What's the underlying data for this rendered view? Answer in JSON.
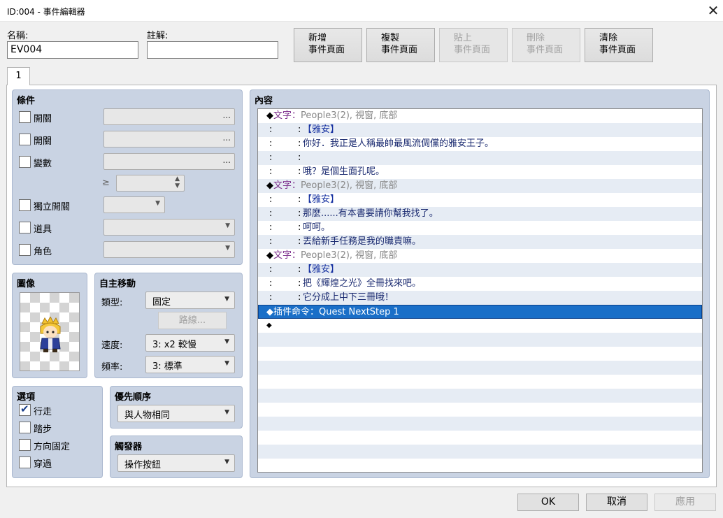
{
  "window": {
    "title": "ID:004 - 事件編輯器",
    "close_icon": "close-icon"
  },
  "header": {
    "name_label": "名稱:",
    "name_value": "EV004",
    "note_label": "註解:",
    "note_value": ""
  },
  "toolbar": {
    "buttons": [
      {
        "line1": "新增",
        "line2": "事件頁面",
        "enabled": true
      },
      {
        "line1": "複製",
        "line2": "事件頁面",
        "enabled": true
      },
      {
        "line1": "貼上",
        "line2": "事件頁面",
        "enabled": false
      },
      {
        "line1": "刪除",
        "line2": "事件頁面",
        "enabled": false
      },
      {
        "line1": "清除",
        "line2": "事件頁面",
        "enabled": true
      }
    ]
  },
  "tabs": [
    {
      "label": "1"
    }
  ],
  "conditions": {
    "title": "條件",
    "switch1_label": "開關",
    "switch2_label": "開關",
    "variable_label": "變數",
    "gte_symbol": "≥",
    "self_switch_label": "獨立開關",
    "item_label": "道具",
    "actor_label": "角色",
    "dots": "..."
  },
  "image": {
    "title": "圖像",
    "sprite": "character-sprite"
  },
  "autonomous": {
    "title": "自主移動",
    "type_label": "類型:",
    "type_value": "固定",
    "route_button": "路線...",
    "speed_label": "速度:",
    "speed_value": "3: x2 較慢",
    "freq_label": "頻率:",
    "freq_value": "3: 標準"
  },
  "options": {
    "title": "選項",
    "items": [
      {
        "label": "行走",
        "checked": true
      },
      {
        "label": "踏步",
        "checked": false
      },
      {
        "label": "方向固定",
        "checked": false
      },
      {
        "label": "穿過",
        "checked": false
      }
    ]
  },
  "priority": {
    "title": "優先順序",
    "value": "與人物相同"
  },
  "trigger": {
    "title": "觸發器",
    "value": "操作按鈕"
  },
  "contents": {
    "title": "內容",
    "rows": [
      {
        "type": "cmd",
        "cmd": "文字",
        "sep": "：",
        "param": "People3(2), 視窗, 底部"
      },
      {
        "type": "line",
        "c1": ":",
        "c2": ":",
        "text": "【雅安】",
        "style": "name"
      },
      {
        "type": "line",
        "c1": ":",
        "c2": ":",
        "text": "你好．我正是人稱最帥最風流倜儻的雅安王子。",
        "style": "msg"
      },
      {
        "type": "line",
        "c1": ":",
        "c2": ":",
        "text": "",
        "style": "msg"
      },
      {
        "type": "line",
        "c1": ":",
        "c2": ":",
        "text": "哦？是個生面孔呢。",
        "style": "msg"
      },
      {
        "type": "cmd",
        "cmd": "文字",
        "sep": "：",
        "param": "People3(2), 視窗, 底部"
      },
      {
        "type": "line",
        "c1": ":",
        "c2": ":",
        "text": "【雅安】",
        "style": "name"
      },
      {
        "type": "line",
        "c1": ":",
        "c2": ":",
        "text": "那麼......有本書要請你幫我找了。",
        "style": "msg"
      },
      {
        "type": "line",
        "c1": ":",
        "c2": ":",
        "text": "呵呵。",
        "style": "msg"
      },
      {
        "type": "line",
        "c1": ":",
        "c2": ":",
        "text": "丟給新手任務是我的職責嘛。",
        "style": "msg"
      },
      {
        "type": "cmd",
        "cmd": "文字",
        "sep": "：",
        "param": "People3(2), 視窗, 底部"
      },
      {
        "type": "line",
        "c1": ":",
        "c2": ":",
        "text": "【雅安】",
        "style": "name"
      },
      {
        "type": "line",
        "c1": ":",
        "c2": ":",
        "text": "把《輝煌之光》全冊找來吧。",
        "style": "msg"
      },
      {
        "type": "line",
        "c1": ":",
        "c2": ":",
        "text": "它分成上中下三冊哦！",
        "style": "msg"
      },
      {
        "type": "selected",
        "cmd": "插件命令",
        "sep": "：",
        "param": "Quest NextStep 1"
      },
      {
        "type": "end",
        "bullet": "◆"
      }
    ],
    "bullet": "◆",
    "empty_rows": 10
  },
  "footer": {
    "ok": "OK",
    "cancel": "取消",
    "apply": "應用"
  }
}
